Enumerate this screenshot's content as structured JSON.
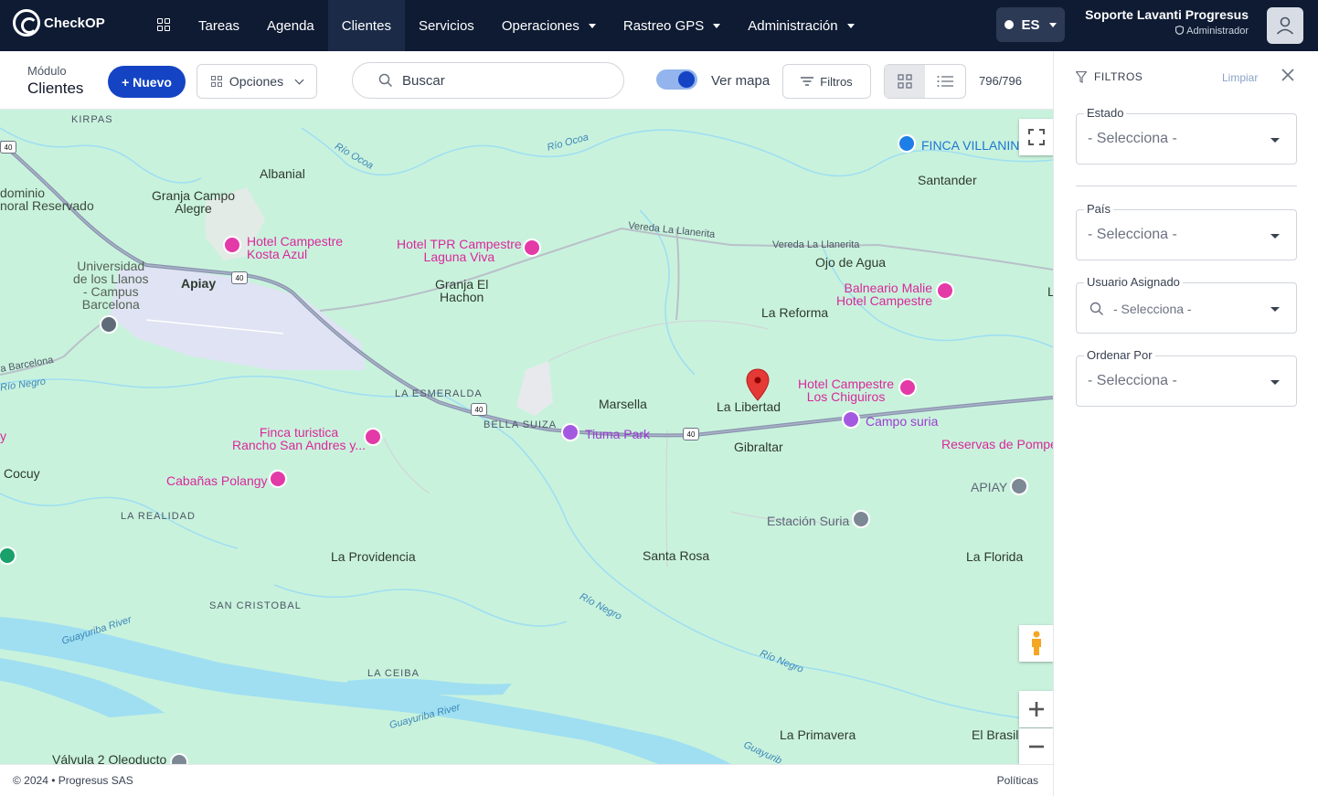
{
  "app": {
    "name": "CheckOP"
  },
  "nav": {
    "items": [
      {
        "label": "Tareas",
        "dropdown": false,
        "active": false
      },
      {
        "label": "Agenda",
        "dropdown": false,
        "active": false
      },
      {
        "label": "Clientes",
        "dropdown": false,
        "active": true
      },
      {
        "label": "Servicios",
        "dropdown": false,
        "active": false
      },
      {
        "label": "Operaciones",
        "dropdown": true,
        "active": false
      },
      {
        "label": "Rastreo GPS",
        "dropdown": true,
        "active": false
      },
      {
        "label": "Administración",
        "dropdown": true,
        "active": false
      }
    ],
    "language": "ES"
  },
  "user": {
    "name": "Soporte Lavanti Progresus",
    "role": "Administrador"
  },
  "toolbar": {
    "module_caption": "Módulo",
    "module_title": "Clientes",
    "new_label": "+ Nuevo",
    "options_label": "Opciones",
    "search_placeholder": "Buscar",
    "map_toggle_label": "Ver mapa",
    "map_toggle_on": true,
    "filters_label": "Filtros",
    "count": "796/796"
  },
  "map": {
    "places": {
      "kirpas": "KIRPAS",
      "albanial": "Albanial",
      "granja_campo_alegre_1": "Granja Campo",
      "granja_campo_alegre_2": "Alegre",
      "dominio_1": "dominio",
      "dominio_2": "noral Reservado",
      "universidad_1": "Universidad",
      "universidad_2": "de los Llanos",
      "universidad_3": "- Campus",
      "universidad_4": "Barcelona",
      "apiay": "Apiay",
      "granja_hachon_1": "Granja El",
      "granja_hachon_2": "Hachon",
      "santander": "Santander",
      "ojo_de_agua": "Ojo de Agua",
      "la_reforma": "La Reforma",
      "la_esmeralda": "LA ESMERALDA",
      "bella_suiza": "BELLA SUIZA",
      "marsella": "Marsella",
      "la_libertad": "La Libertad",
      "gibraltar": "Gibraltar",
      "cocuy": "Cocuy",
      "la_realidad": "LA REALIDAD",
      "la_providencia": "La Providencia",
      "santa_rosa": "Santa Rosa",
      "la_florida": "La Florida",
      "san_cristobal": "SAN CRISTOBAL",
      "la_ceiba": "LA CEIBA",
      "la_primavera": "La Primavera",
      "el_brasil": "El Brasil",
      "valvula": "Válvula 2 Oleoducto",
      "barcelona_road": "a Barcelona",
      "l_edge": "L",
      "y_edge": "y"
    },
    "pois": {
      "finca_villanina": "FINCA VILLANIN",
      "kosta_azul_1": "Hotel Campestre",
      "kosta_azul_2": "Kosta Azul",
      "tpr_1": "Hotel TPR Campestre",
      "tpr_2": "Laguna Viva",
      "malie_1": "Balneario Malie",
      "malie_2": "Hotel Campestre",
      "chiguiros_1": "Hotel Campestre",
      "chiguiros_2": "Los Chiguiros",
      "tiuma": "Tiuma Park",
      "campo_suria": "Campo suria",
      "reservas": "Reservas de Pompe",
      "finca_turistica_1": "Finca turistica",
      "finca_turistica_2": "Rancho San Andres y...",
      "polangy": "Cabañas Polangy",
      "apiay_station": "APIAY",
      "estacion_suria": "Estación Suria"
    },
    "roads": {
      "llanerita_1": "Vereda La Llanerita",
      "llanerita_2": "Vereda La Llanerita",
      "route": "40"
    },
    "rivers": {
      "ocoa_1": "Río Ocoa",
      "ocoa_2": "Río Ocoa",
      "negro_1": "Río Negro",
      "negro_2": "Río Negro",
      "negro_3": "Río Negro",
      "guayuriba_1": "Guayuriba River",
      "guayuriba_2": "Guayuriba River",
      "guayuriba_3": "Guayurib"
    }
  },
  "footer": {
    "copyright": "© 2024 • Progresus SAS",
    "policies": "Políticas"
  },
  "filters_panel": {
    "title": "FILTROS",
    "clear_label": "Limpiar",
    "fields": {
      "estado": {
        "label": "Estado",
        "value": "- Selecciona -"
      },
      "pais": {
        "label": "País",
        "value": "- Selecciona -"
      },
      "usuario": {
        "label": "Usuario Asignado",
        "value": "- Selecciona -"
      },
      "orden": {
        "label": "Ordenar Por",
        "value": "- Selecciona -"
      }
    }
  },
  "colors": {
    "topbar": "#0e1b33",
    "primary": "#1444c4",
    "map_land": "#c9f2dd",
    "water": "#9fdff1",
    "poi": "#e33aa8",
    "marker": "#e53935"
  }
}
